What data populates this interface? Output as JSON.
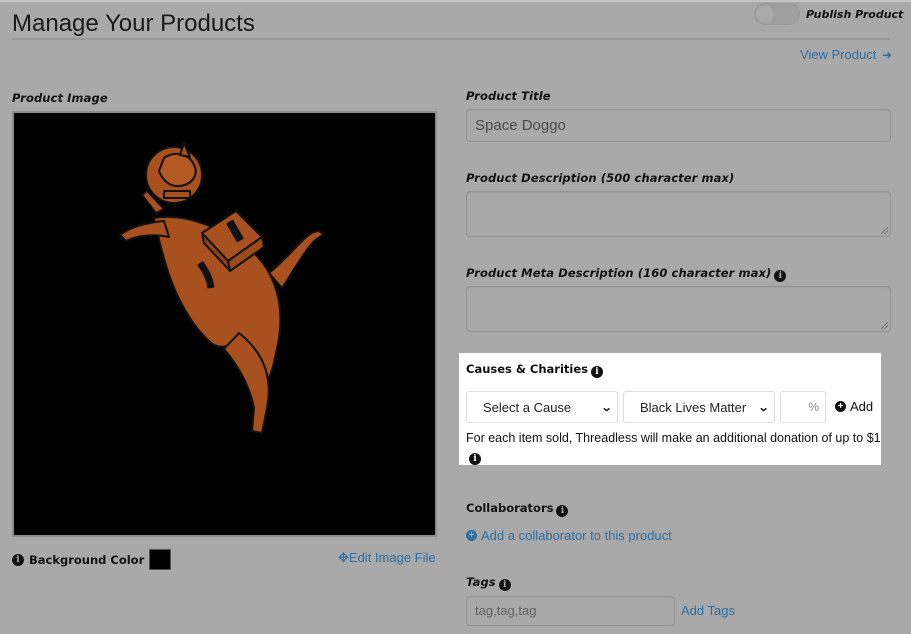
{
  "header": {
    "title": "Manage Your Products",
    "publish_label": "Publish Product",
    "publish_enabled": false,
    "view_product_label": "View Product",
    "view_product_icon": "sign-in-icon"
  },
  "image_panel": {
    "label": "Product Image",
    "image_alt": "Space Doggo design - orange astronaut dog with helmet and bone backpack",
    "background_color_label": "Background Color",
    "background_color": "#000000",
    "edit_image_label": "Edit Image File",
    "edit_image_icon": "move-arrows-icon"
  },
  "form": {
    "title_label": "Product Title",
    "title_value": "Space Doggo",
    "description_label": "Product Description (500 character max)",
    "description_value": "",
    "meta_label": "Product Meta Description (160 character max)",
    "meta_value": "",
    "causes": {
      "title": "Causes & Charities",
      "cause_select": "Select a Cause",
      "charity_select": "Black Lives Matter",
      "percent_placeholder": "%",
      "add_label": "Add",
      "note": "For each item sold, Threadless will make an additional donation of up to $1"
    },
    "collaborators": {
      "label": "Collaborators",
      "add_label": "Add a collaborator to this product"
    },
    "tags": {
      "label": "Tags",
      "placeholder": "tag,tag,tag",
      "add_label": "Add Tags"
    }
  },
  "colors": {
    "link": "#2d6fa3",
    "overlay_bg": "#a9a9a9",
    "highlight_panel": "#ffffff",
    "dog_orange": "#a8511f"
  }
}
